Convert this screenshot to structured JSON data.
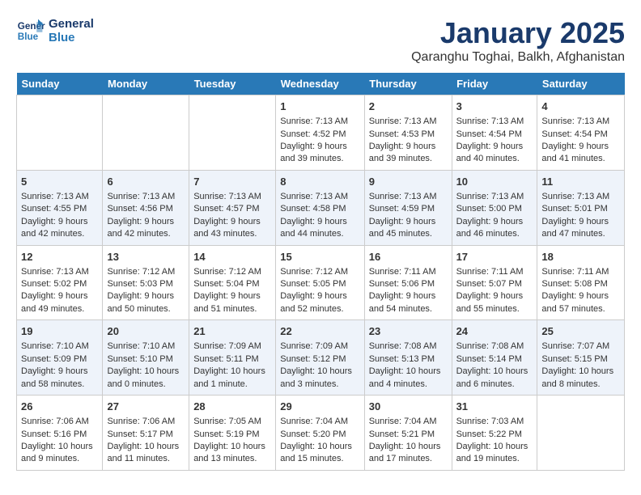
{
  "logo": {
    "line1": "General",
    "line2": "Blue"
  },
  "title": "January 2025",
  "subtitle": "Qaranghu Toghai, Balkh, Afghanistan",
  "days": [
    "Sunday",
    "Monday",
    "Tuesday",
    "Wednesday",
    "Thursday",
    "Friday",
    "Saturday"
  ],
  "weeks": [
    {
      "cells": [
        {
          "date": "",
          "content": ""
        },
        {
          "date": "",
          "content": ""
        },
        {
          "date": "",
          "content": ""
        },
        {
          "date": "1",
          "content": "Sunrise: 7:13 AM\nSunset: 4:52 PM\nDaylight: 9 hours and 39 minutes."
        },
        {
          "date": "2",
          "content": "Sunrise: 7:13 AM\nSunset: 4:53 PM\nDaylight: 9 hours and 39 minutes."
        },
        {
          "date": "3",
          "content": "Sunrise: 7:13 AM\nSunset: 4:54 PM\nDaylight: 9 hours and 40 minutes."
        },
        {
          "date": "4",
          "content": "Sunrise: 7:13 AM\nSunset: 4:54 PM\nDaylight: 9 hours and 41 minutes."
        }
      ]
    },
    {
      "cells": [
        {
          "date": "5",
          "content": "Sunrise: 7:13 AM\nSunset: 4:55 PM\nDaylight: 9 hours and 42 minutes."
        },
        {
          "date": "6",
          "content": "Sunrise: 7:13 AM\nSunset: 4:56 PM\nDaylight: 9 hours and 42 minutes."
        },
        {
          "date": "7",
          "content": "Sunrise: 7:13 AM\nSunset: 4:57 PM\nDaylight: 9 hours and 43 minutes."
        },
        {
          "date": "8",
          "content": "Sunrise: 7:13 AM\nSunset: 4:58 PM\nDaylight: 9 hours and 44 minutes."
        },
        {
          "date": "9",
          "content": "Sunrise: 7:13 AM\nSunset: 4:59 PM\nDaylight: 9 hours and 45 minutes."
        },
        {
          "date": "10",
          "content": "Sunrise: 7:13 AM\nSunset: 5:00 PM\nDaylight: 9 hours and 46 minutes."
        },
        {
          "date": "11",
          "content": "Sunrise: 7:13 AM\nSunset: 5:01 PM\nDaylight: 9 hours and 47 minutes."
        }
      ]
    },
    {
      "cells": [
        {
          "date": "12",
          "content": "Sunrise: 7:13 AM\nSunset: 5:02 PM\nDaylight: 9 hours and 49 minutes."
        },
        {
          "date": "13",
          "content": "Sunrise: 7:12 AM\nSunset: 5:03 PM\nDaylight: 9 hours and 50 minutes."
        },
        {
          "date": "14",
          "content": "Sunrise: 7:12 AM\nSunset: 5:04 PM\nDaylight: 9 hours and 51 minutes."
        },
        {
          "date": "15",
          "content": "Sunrise: 7:12 AM\nSunset: 5:05 PM\nDaylight: 9 hours and 52 minutes."
        },
        {
          "date": "16",
          "content": "Sunrise: 7:11 AM\nSunset: 5:06 PM\nDaylight: 9 hours and 54 minutes."
        },
        {
          "date": "17",
          "content": "Sunrise: 7:11 AM\nSunset: 5:07 PM\nDaylight: 9 hours and 55 minutes."
        },
        {
          "date": "18",
          "content": "Sunrise: 7:11 AM\nSunset: 5:08 PM\nDaylight: 9 hours and 57 minutes."
        }
      ]
    },
    {
      "cells": [
        {
          "date": "19",
          "content": "Sunrise: 7:10 AM\nSunset: 5:09 PM\nDaylight: 9 hours and 58 minutes."
        },
        {
          "date": "20",
          "content": "Sunrise: 7:10 AM\nSunset: 5:10 PM\nDaylight: 10 hours and 0 minutes."
        },
        {
          "date": "21",
          "content": "Sunrise: 7:09 AM\nSunset: 5:11 PM\nDaylight: 10 hours and 1 minute."
        },
        {
          "date": "22",
          "content": "Sunrise: 7:09 AM\nSunset: 5:12 PM\nDaylight: 10 hours and 3 minutes."
        },
        {
          "date": "23",
          "content": "Sunrise: 7:08 AM\nSunset: 5:13 PM\nDaylight: 10 hours and 4 minutes."
        },
        {
          "date": "24",
          "content": "Sunrise: 7:08 AM\nSunset: 5:14 PM\nDaylight: 10 hours and 6 minutes."
        },
        {
          "date": "25",
          "content": "Sunrise: 7:07 AM\nSunset: 5:15 PM\nDaylight: 10 hours and 8 minutes."
        }
      ]
    },
    {
      "cells": [
        {
          "date": "26",
          "content": "Sunrise: 7:06 AM\nSunset: 5:16 PM\nDaylight: 10 hours and 9 minutes."
        },
        {
          "date": "27",
          "content": "Sunrise: 7:06 AM\nSunset: 5:17 PM\nDaylight: 10 hours and 11 minutes."
        },
        {
          "date": "28",
          "content": "Sunrise: 7:05 AM\nSunset: 5:19 PM\nDaylight: 10 hours and 13 minutes."
        },
        {
          "date": "29",
          "content": "Sunrise: 7:04 AM\nSunset: 5:20 PM\nDaylight: 10 hours and 15 minutes."
        },
        {
          "date": "30",
          "content": "Sunrise: 7:04 AM\nSunset: 5:21 PM\nDaylight: 10 hours and 17 minutes."
        },
        {
          "date": "31",
          "content": "Sunrise: 7:03 AM\nSunset: 5:22 PM\nDaylight: 10 hours and 19 minutes."
        },
        {
          "date": "",
          "content": ""
        }
      ]
    }
  ]
}
